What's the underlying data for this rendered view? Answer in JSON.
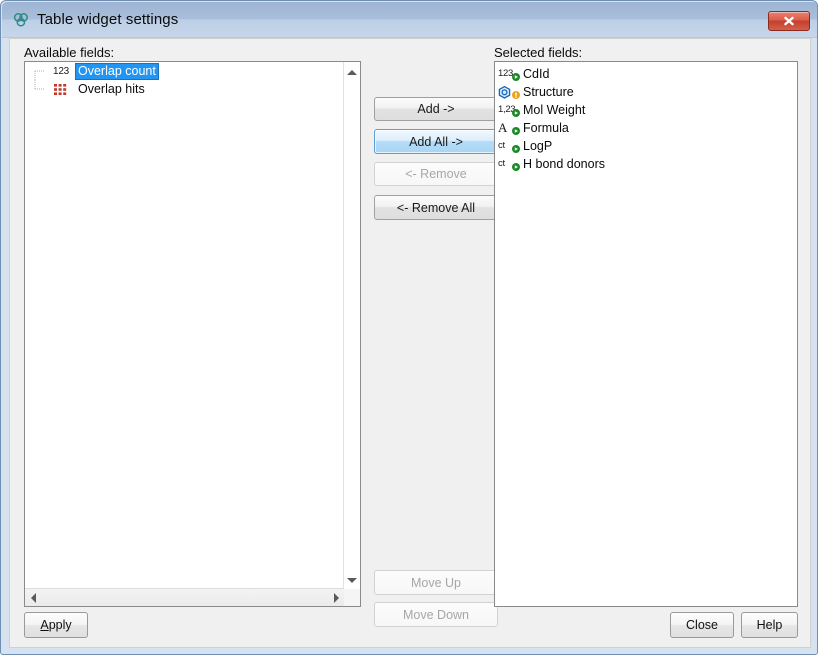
{
  "window": {
    "title": "Table widget settings",
    "app_icon": "molecule-icon",
    "close_label": "Close window",
    "titlebar_color_start": "#9db5d3",
    "titlebar_color_end": "#c6d6ea",
    "close_button_color": "#c33f2c"
  },
  "available": {
    "label": "Available fields:",
    "items": [
      {
        "label": "Overlap count",
        "icon": "number-123-icon",
        "selected": true
      },
      {
        "label": "Overlap hits",
        "icon": "table-grid-icon",
        "selected": false
      }
    ],
    "selection_color": "#2294f2"
  },
  "selected": {
    "label": "Selected fields:",
    "items": [
      {
        "label": "CdId",
        "icon": "number-123-icon",
        "glyph": "123",
        "badge": "green-arrow-badge"
      },
      {
        "label": "Structure",
        "icon": "structure-hexagon-icon",
        "glyph": "",
        "badge": "orange-warning-badge"
      },
      {
        "label": "Mol Weight",
        "icon": "decimal-number-icon",
        "glyph": "1,23",
        "badge": "green-arrow-badge"
      },
      {
        "label": "Formula",
        "icon": "text-letter-a-icon",
        "glyph": "A",
        "badge": "green-arrow-badge"
      },
      {
        "label": "LogP",
        "icon": "text-ct-icon",
        "glyph": "ct",
        "badge": "green-arrow-badge"
      },
      {
        "label": "H bond donors",
        "icon": "text-ct-icon",
        "glyph": "ct",
        "badge": "green-arrow-badge"
      }
    ]
  },
  "transfer_buttons": [
    {
      "label": "Add ->",
      "state": "normal"
    },
    {
      "label": "Add All ->",
      "state": "hover"
    },
    {
      "label": "<- Remove",
      "state": "disabled"
    },
    {
      "label": "<- Remove All",
      "state": "normal"
    }
  ],
  "order_buttons": [
    {
      "label": "Move Up",
      "state": "disabled"
    },
    {
      "label": "Move Down",
      "state": "disabled"
    }
  ],
  "footer": {
    "apply_mnemonic": "A",
    "apply_rest": "pply",
    "close_label": "Close",
    "help_label": "Help"
  },
  "scrollbars": {
    "up_arrow": "triangle-up-icon",
    "down_arrow": "triangle-down-icon",
    "left_arrow": "triangle-left-icon",
    "right_arrow": "triangle-right-icon"
  }
}
